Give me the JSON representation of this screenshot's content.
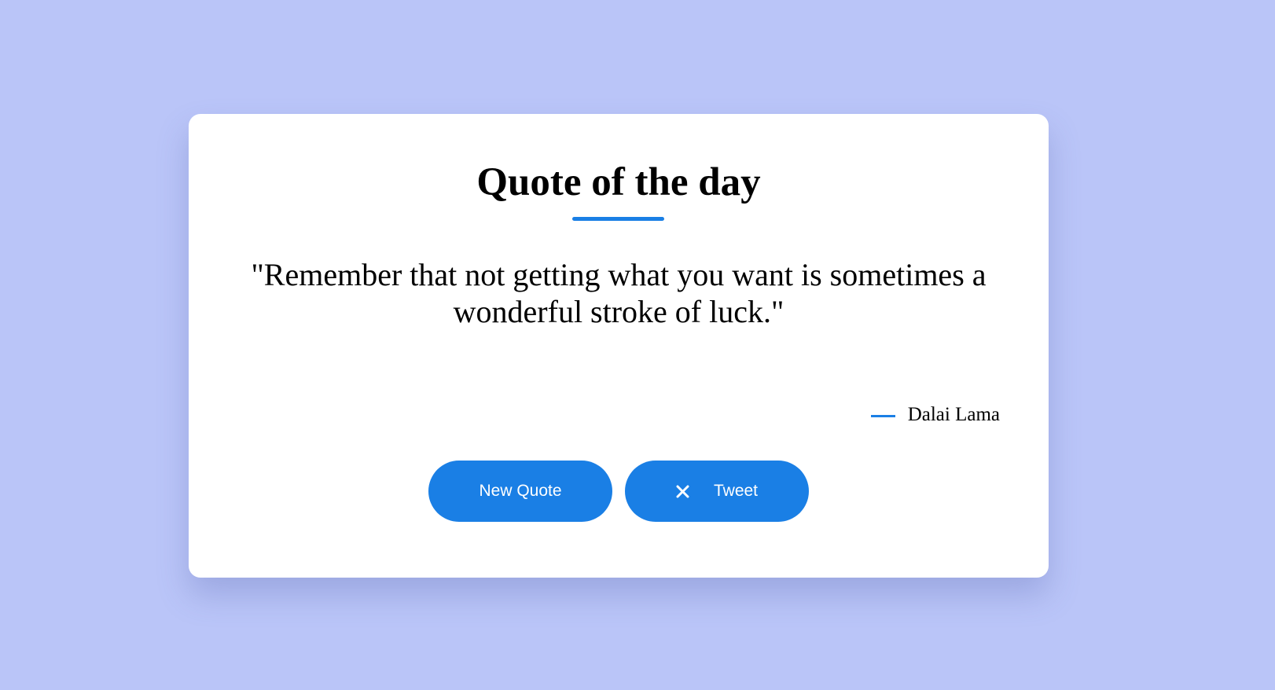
{
  "card": {
    "title": "Quote of the day",
    "quote": "\"Remember that not getting what you want is sometimes a wonderful stroke of luck.\"",
    "author": "Dalai Lama"
  },
  "actions": {
    "new_quote_label": "New Quote",
    "tweet_label": "Tweet",
    "tweet_icon": "x-logo-icon"
  },
  "colors": {
    "background": "#bac5f8",
    "card": "#ffffff",
    "accent": "#1a7fe5",
    "button_text": "#ffffff"
  }
}
